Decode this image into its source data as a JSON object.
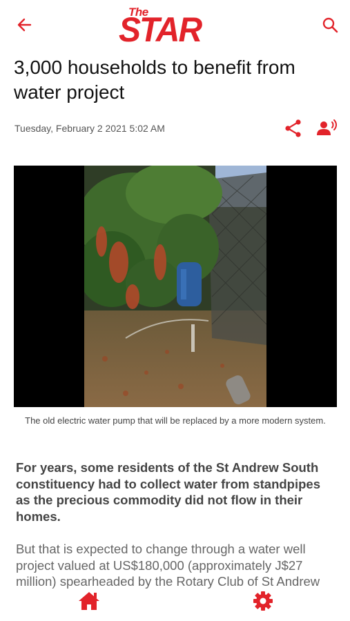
{
  "header": {
    "logo_small": "The",
    "logo_main": "STAR",
    "back_icon": "arrow-left-icon",
    "search_icon": "search-icon"
  },
  "article": {
    "headline": "3,000 households to benefit from water project",
    "date": "Tuesday, February 2 2021 5:02 AM",
    "share_icon": "share-icon",
    "listen_icon": "text-to-speech-icon",
    "photo_caption": "The old electric water pump that will be replaced by a more modern system.",
    "lead_paragraph": " For years, some residents of the St Andrew South constituency had to collect water from standpipes as the precious commodity did not flow in their homes.",
    "body_paragraph": "But that is expected to change through a water well project valued at US$180,000 (approximately J$27 million) spearheaded by the Rotary Club of St Andrew"
  },
  "bottom_nav": {
    "home_icon": "home-icon",
    "settings_icon": "gear-icon"
  },
  "colors": {
    "brand_red": "#e2232a",
    "text_dark": "#111111",
    "text_muted": "#555555"
  }
}
